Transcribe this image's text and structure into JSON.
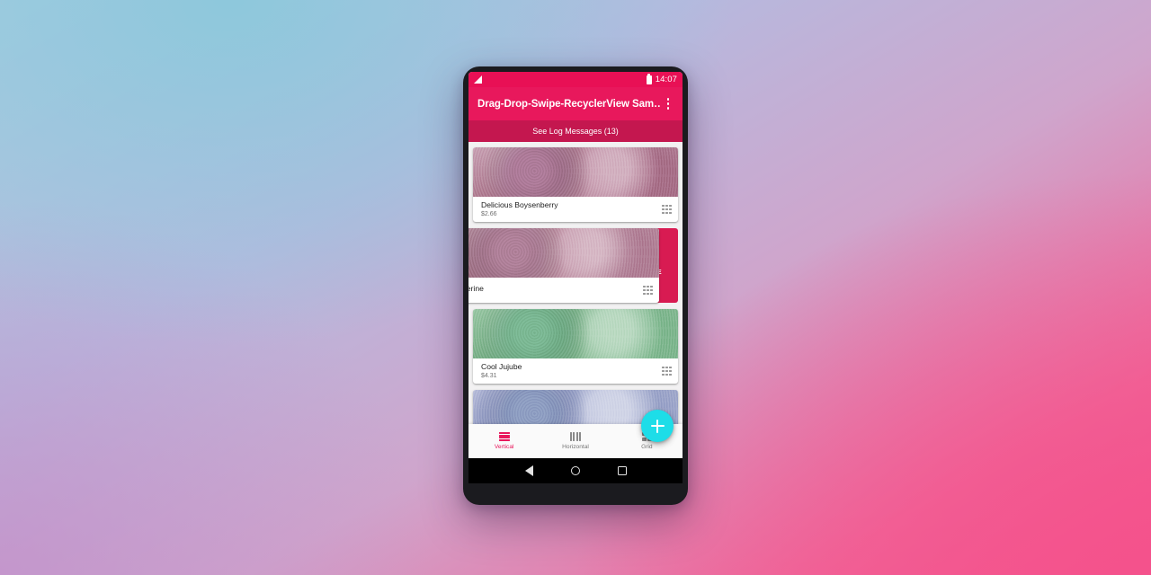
{
  "status_bar": {
    "time": "14:07",
    "signal_icon": "signal-triangle-icon",
    "battery_icon": "battery-icon"
  },
  "app_bar": {
    "title": "Drag-Drop-Swipe-RecyclerView Sam…",
    "overflow_icon": "overflow-menu-icon",
    "background": "#e8185c"
  },
  "log_bar": {
    "label": "See Log Messages (13)",
    "background": "#c4174f"
  },
  "list": {
    "items": [
      {
        "title": "Delicious Boysenberry",
        "price": "$2.66",
        "image": "ice-berry",
        "handle_icon": "drag-handle-icon",
        "swiped": false
      },
      {
        "title": "gerine",
        "price": "",
        "image": "ice-tangerine",
        "handle_icon": "drag-handle-icon",
        "swiped": true,
        "swipe_action": {
          "label": "DELETE",
          "icon": "trash-icon",
          "background": "#d81b52"
        }
      },
      {
        "title": "Cool Jujube",
        "price": "$4.31",
        "image": "ice-jujube",
        "handle_icon": "drag-handle-icon",
        "swiped": false
      },
      {
        "title": "",
        "price": "",
        "image": "ice-blue",
        "handle_icon": "drag-handle-icon",
        "swiped": false
      }
    ]
  },
  "fab": {
    "icon": "plus-icon",
    "color": "#1ddde8"
  },
  "bottom_nav": {
    "items": [
      {
        "label": "Vertical",
        "icon": "list-vertical-icon",
        "active": true
      },
      {
        "label": "Horizontal",
        "icon": "list-horizontal-icon",
        "active": false
      },
      {
        "label": "Grid",
        "icon": "grid-icon",
        "active": false
      }
    ],
    "active_color": "#e8185c",
    "inactive_color": "#757575"
  },
  "android_nav": {
    "back_icon": "back-triangle-icon",
    "home_icon": "home-circle-icon",
    "recents_icon": "recents-square-icon"
  }
}
